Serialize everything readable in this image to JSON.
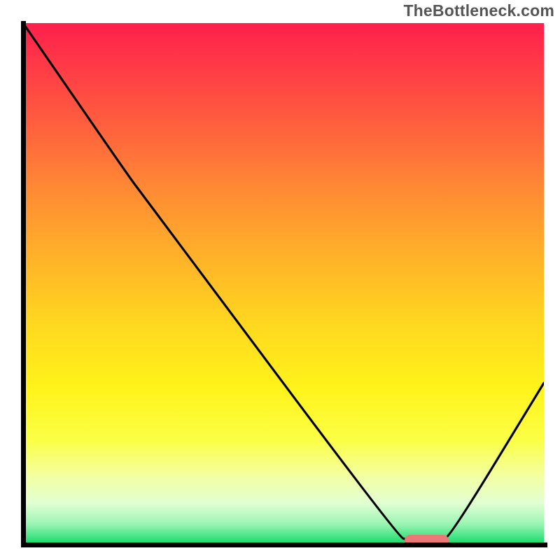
{
  "watermark": "TheBottleneck.com",
  "colors": {
    "axis": "#000000",
    "curve": "#000000",
    "marker": "#ec7777",
    "gradient_top": "#ff1f4b",
    "gradient_bottom": "#12d96a"
  },
  "chart_data": {
    "type": "line",
    "title": "",
    "xlabel": "",
    "ylabel": "",
    "xlim": [
      0,
      100
    ],
    "ylim": [
      0,
      100
    ],
    "curve_points": [
      {
        "x": 0,
        "y": 100
      },
      {
        "x": 20,
        "y": 71
      },
      {
        "x": 23,
        "y": 67
      },
      {
        "x": 72,
        "y": 1.5
      },
      {
        "x": 74,
        "y": 0.8
      },
      {
        "x": 80,
        "y": 0.8
      },
      {
        "x": 82,
        "y": 1.5
      },
      {
        "x": 100,
        "y": 31
      }
    ],
    "marker": {
      "x_center": 77.5,
      "width_pct": 8.5,
      "y": 0.8
    },
    "annotations": []
  }
}
